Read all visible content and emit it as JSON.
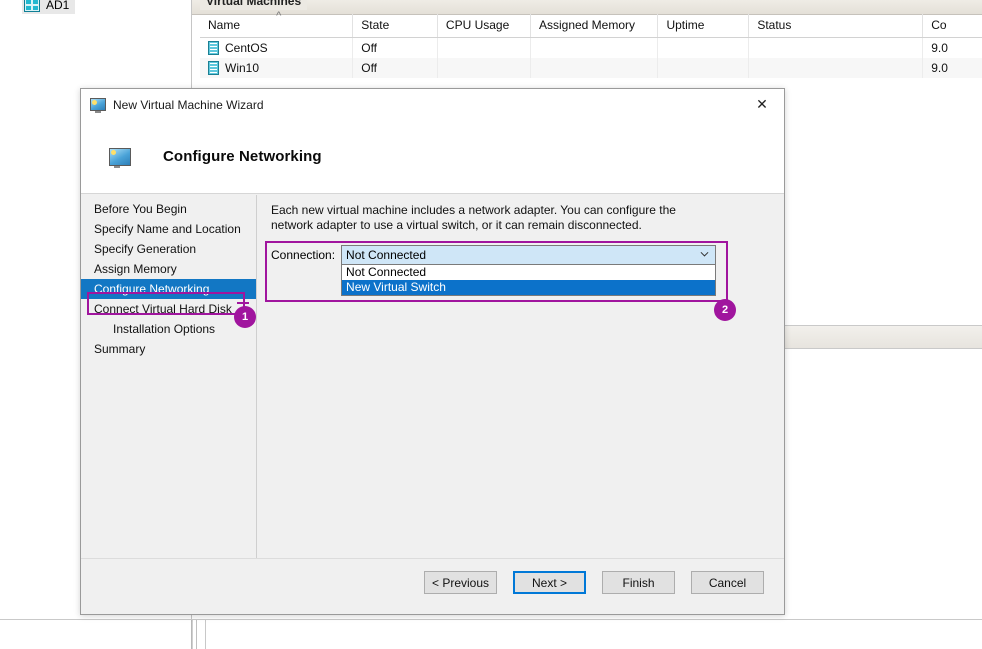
{
  "background": {
    "tree": {
      "node_label": "AD1",
      "node_icon": "grid-icon"
    },
    "group_title": "Virtual Machines",
    "table": {
      "columns": [
        "Name",
        "State",
        "CPU Usage",
        "Assigned Memory",
        "Uptime",
        "Status",
        "Co"
      ],
      "sorted_column": "Name",
      "rows": [
        {
          "name": "CentOS",
          "icon": "virtual-machine-icon",
          "state": "Off",
          "cpu_usage": "",
          "assigned_memory": "",
          "uptime": "",
          "status": "",
          "configuration_version": "9.0"
        },
        {
          "name": "Win10",
          "icon": "virtual-machine-icon",
          "state": "Off",
          "cpu_usage": "",
          "assigned_memory": "",
          "uptime": "",
          "status": "",
          "configuration_version": "9.0"
        }
      ]
    }
  },
  "wizard": {
    "title": "New Virtual Machine Wizard",
    "title_icon": "monitor-icon",
    "close_label": "✕",
    "header": {
      "icon": "monitor-icon",
      "title": "Configure Networking"
    },
    "sidebar": {
      "items": [
        {
          "label": "Before You Begin",
          "active": false,
          "indent": false
        },
        {
          "label": "Specify Name and Location",
          "active": false,
          "indent": false
        },
        {
          "label": "Specify Generation",
          "active": false,
          "indent": false
        },
        {
          "label": "Assign Memory",
          "active": false,
          "indent": false
        },
        {
          "label": "Configure Networking",
          "active": true,
          "indent": false
        },
        {
          "label": "Connect Virtual Hard Disk",
          "active": false,
          "indent": false
        },
        {
          "label": "Installation Options",
          "active": false,
          "indent": true
        },
        {
          "label": "Summary",
          "active": false,
          "indent": false
        }
      ]
    },
    "content": {
      "description": "Each new virtual machine includes a network adapter. You can configure the network adapter to use a virtual switch, or it can remain disconnected.",
      "connection_label": "Connection:",
      "connection_value": "Not Connected",
      "dropdown_open": true,
      "dropdown_options": [
        {
          "label": "Not Connected",
          "selected": false
        },
        {
          "label": "New Virtual Switch",
          "selected": true
        }
      ]
    },
    "footer": {
      "buttons": [
        {
          "label": "< Previous",
          "focused": false
        },
        {
          "label": "Next >",
          "focused": true
        },
        {
          "label": "Finish",
          "focused": false
        },
        {
          "label": "Cancel",
          "focused": false
        }
      ]
    }
  },
  "annotations": {
    "accent_color": "#a0159e",
    "badges": [
      {
        "number": "1",
        "target": "configure-networking-step"
      },
      {
        "number": "2",
        "target": "connection-dropdown"
      }
    ]
  }
}
